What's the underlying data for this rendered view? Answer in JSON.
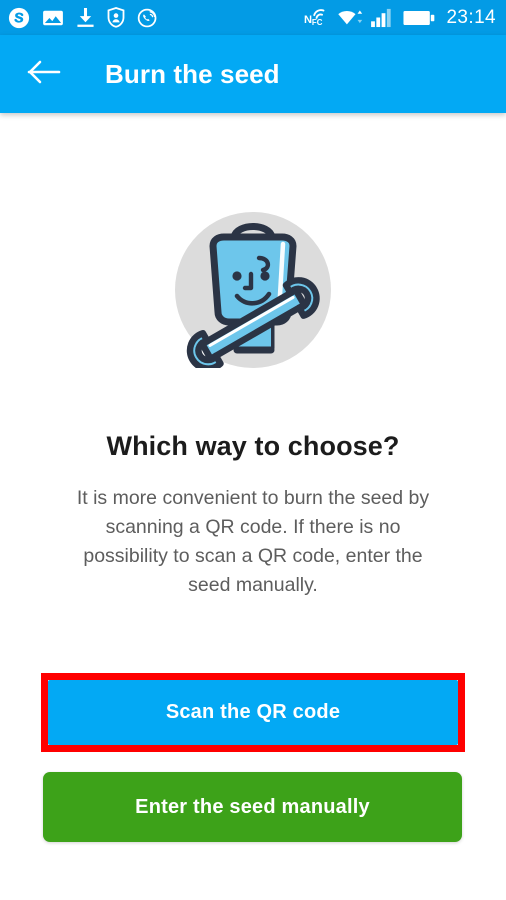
{
  "status_bar": {
    "background": "#039BE5",
    "time": "23:14",
    "left_icons": [
      {
        "name": "skype-icon",
        "label": "Skype"
      },
      {
        "name": "gallery-image-icon",
        "label": "Gallery"
      },
      {
        "name": "download-icon",
        "label": "Download"
      },
      {
        "name": "shield-badge-icon",
        "label": "Security"
      },
      {
        "name": "viber-icon",
        "label": "Viber"
      }
    ],
    "right_icons": [
      {
        "name": "nfc-icon",
        "label": "NFC"
      },
      {
        "name": "wifi-icon",
        "label": "Wi-Fi"
      },
      {
        "name": "signal-bars-icon",
        "label": "Mobile signal"
      },
      {
        "name": "battery-icon",
        "label": "Battery"
      }
    ]
  },
  "app_bar": {
    "background": "#03A9F4",
    "back_icon": "arrow-left-icon",
    "title": "Burn the seed"
  },
  "main": {
    "illustration": {
      "name": "mascot-with-wrench-illustration",
      "circle_color": "#DCDCDC",
      "body_color": "#6DC6EB",
      "outline_color": "#2B3445"
    },
    "headline": "Which way to choose?",
    "body_text": "It is more convenient to burn the seed by scanning a QR code. If there is no possibility to scan a QR code, enter the seed manually.",
    "buttons": {
      "scan": {
        "label": "Scan the QR code",
        "color": "#03A9F4",
        "highlighted": true,
        "highlight_color": "#FF0000"
      },
      "manual": {
        "label": "Enter the seed manually",
        "color": "#3DA219"
      }
    }
  }
}
